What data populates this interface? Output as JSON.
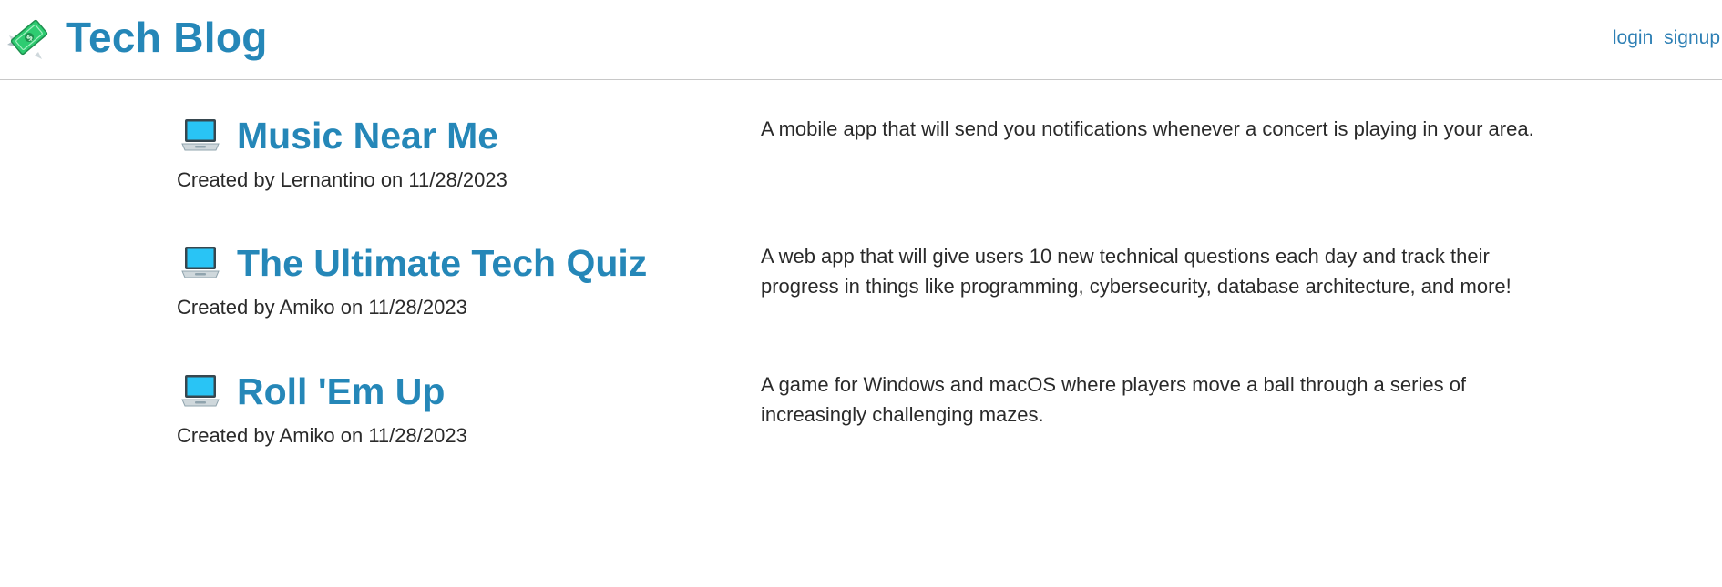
{
  "header": {
    "brand_icon": "money-with-wings-icon",
    "title": "Tech Blog",
    "nav": {
      "login": "login",
      "signup": "signup"
    }
  },
  "posts": [
    {
      "icon": "laptop-icon",
      "title": "Music Near Me",
      "meta": "Created by Lernantino on 11/28/2023",
      "description": "A mobile app that will send you notifications whenever a concert is playing in your area."
    },
    {
      "icon": "laptop-icon",
      "title": "The Ultimate Tech Quiz",
      "meta": "Created by Amiko on 11/28/2023",
      "description": "A web app that will give users 10 new technical questions each day and track their progress in things like programming, cybersecurity, database architecture, and more!"
    },
    {
      "icon": "laptop-icon",
      "title": "Roll 'Em Up",
      "meta": "Created by Amiko on 11/28/2023",
      "description": "A game for Windows and macOS where players move a ball through a series of increasingly challenging mazes."
    }
  ],
  "colors": {
    "accent": "#2587b8",
    "link": "#2d7fb4",
    "text": "#2a2a2a",
    "divider": "#c8c8c8"
  }
}
